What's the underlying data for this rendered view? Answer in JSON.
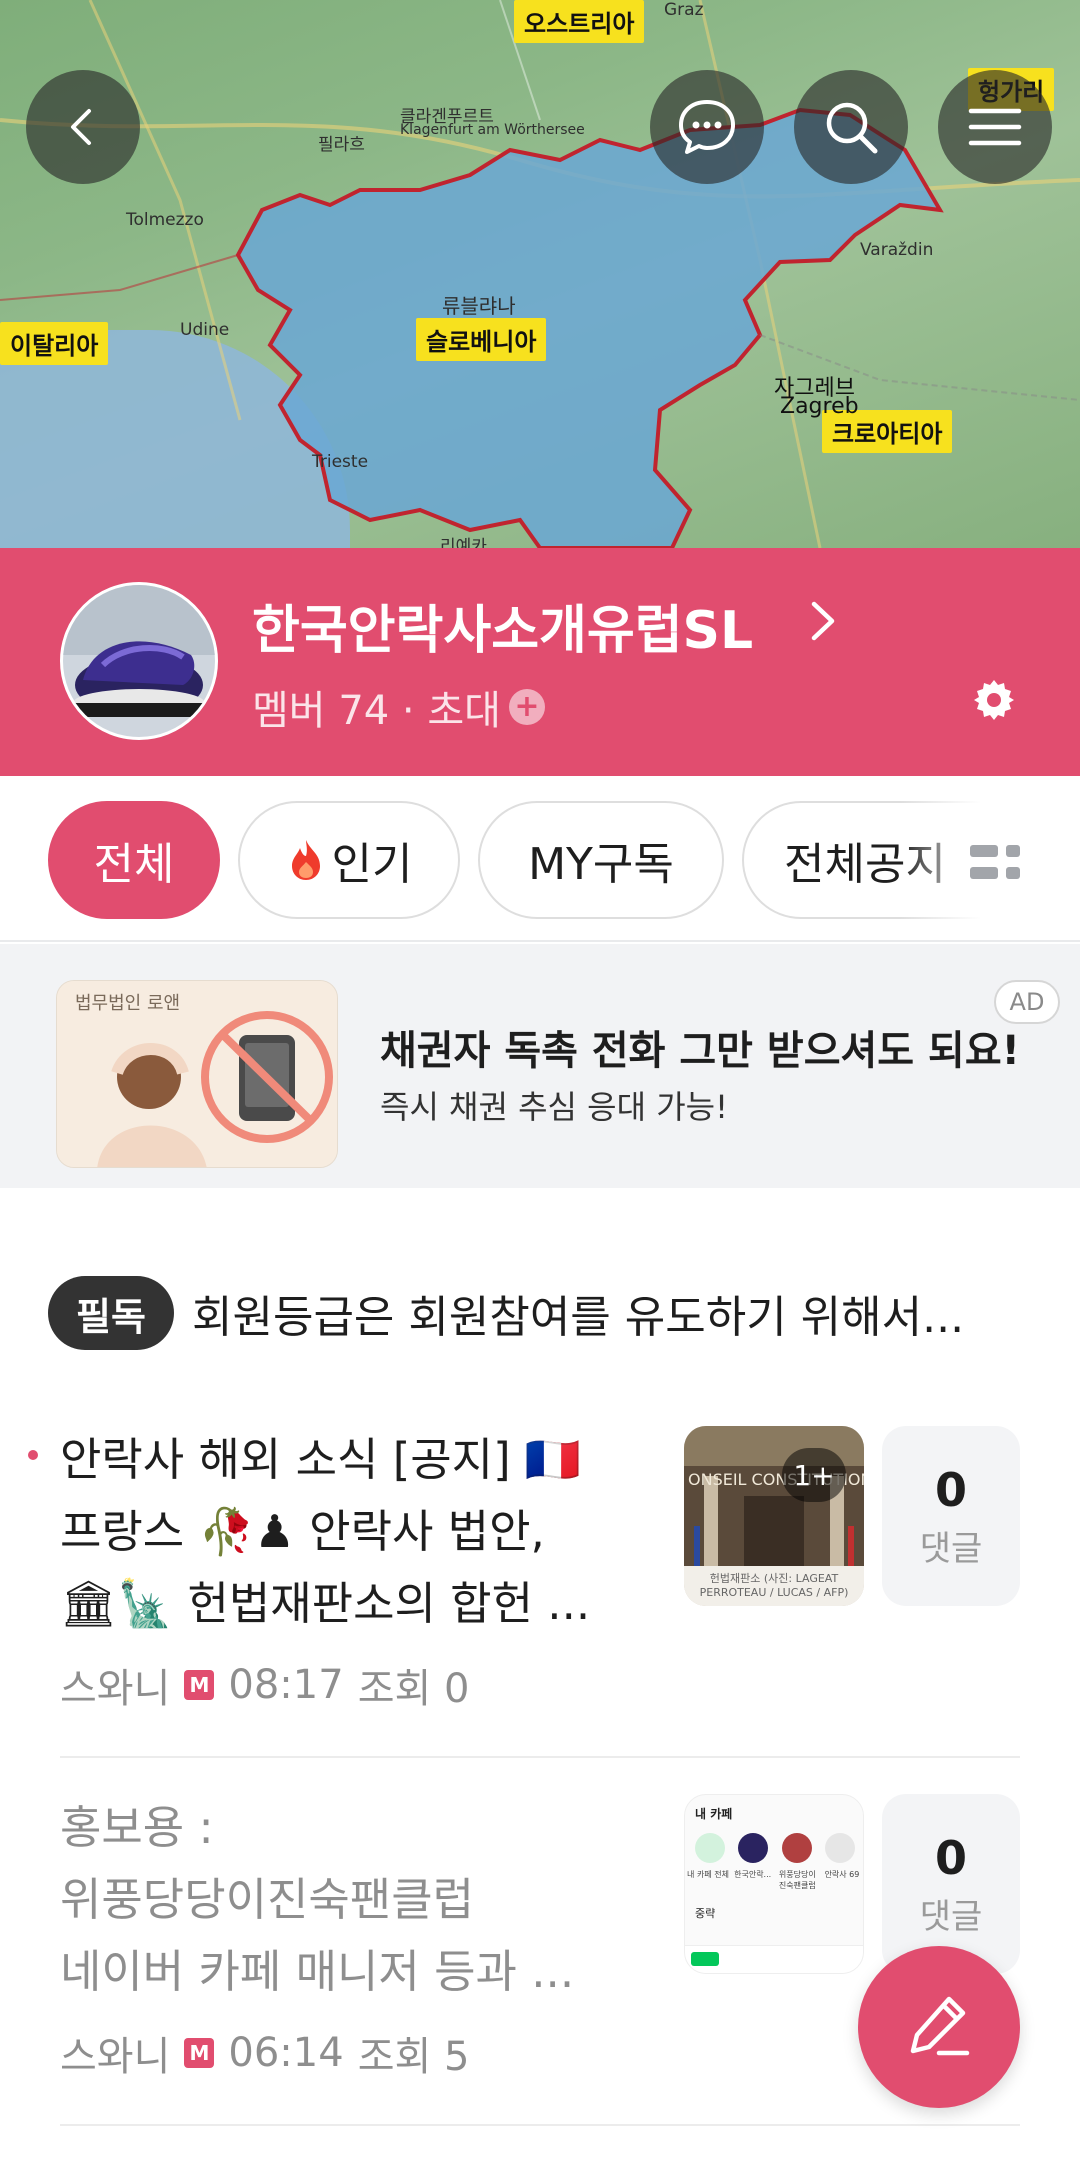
{
  "map": {
    "labels": {
      "austria": "오스트리아",
      "hungary": "헝가리",
      "italy": "이탈리아",
      "slovenia": "슬로베니아",
      "croatia": "크로아티아"
    },
    "cities": {
      "graz": "Graz",
      "ljubljana": "류블랴나",
      "zagreb_kr": "자그레브",
      "zagreb": "Zagreb",
      "klagenfurt": "클라겐푸르트",
      "klagenfurt_en": "Klagenfurt am Wörthersee",
      "villach": "필라흐",
      "udine": "Udine",
      "trieste": "Trieste",
      "tolmezzo": "Tolmezzo",
      "varazdin": "Varaždin",
      "rijeka": "리예카"
    }
  },
  "header": {
    "back_icon": "back-icon",
    "chat_icon": "chat-icon",
    "search_icon": "search-icon",
    "menu_icon": "menu-icon"
  },
  "cafe": {
    "title": "한국안락사소개유럽SL",
    "members_text": "멤버 74 · 초대",
    "accent_color": "#e14d6f"
  },
  "tabs": [
    {
      "label": "전체"
    },
    {
      "label": "인기"
    },
    {
      "label": "MY구독"
    },
    {
      "label": "전체공지"
    }
  ],
  "ad": {
    "image_caption": "법무법인 로앤",
    "title": "채권자 독촉 전화 그만 받으셔도 되요!",
    "subtitle": "즉시 채권 추심 응대 가능!",
    "badge": "AD"
  },
  "notice": {
    "badge": "필독",
    "text": "회원등급은 회원참여를 유도하기 위해서..."
  },
  "posts": [
    {
      "title_lines": [
        "안락사 해외 소식 [공지] 🇫🇷",
        "프랑스 🥀♟ 안락사 법안,",
        "🏛🗽 헌법재판소의 합헌 ..."
      ],
      "author": "스와니",
      "author_badge": "M",
      "time": "08:17",
      "views": "조회 0",
      "thumb_count": "1+",
      "thumb_caption": "헌법재판소 (사진: LAGEAT PERROTEAU / LUCAS / AFP)",
      "thumb_sign": "ONSEIL  CONSTITUTIONNEL",
      "comments": "0",
      "comments_label": "댓글"
    },
    {
      "title_lines": [
        "홍보용 :",
        "위풍당당이진숙팬클럽",
        "네이버 카페 매니저 등과 ..."
      ],
      "author": "스와니",
      "author_badge": "M",
      "time": "06:14",
      "views": "조회 5",
      "thumb_header": "내 카페",
      "thumb_section": "중략",
      "thumb_items": [
        "내 카페 전체",
        "한국안락...",
        "위풍당당이 진숙팬클럽",
        "안락사 69"
      ],
      "comments": "0",
      "comments_label": "댓글"
    }
  ],
  "fab": {
    "icon": "pencil-icon"
  }
}
